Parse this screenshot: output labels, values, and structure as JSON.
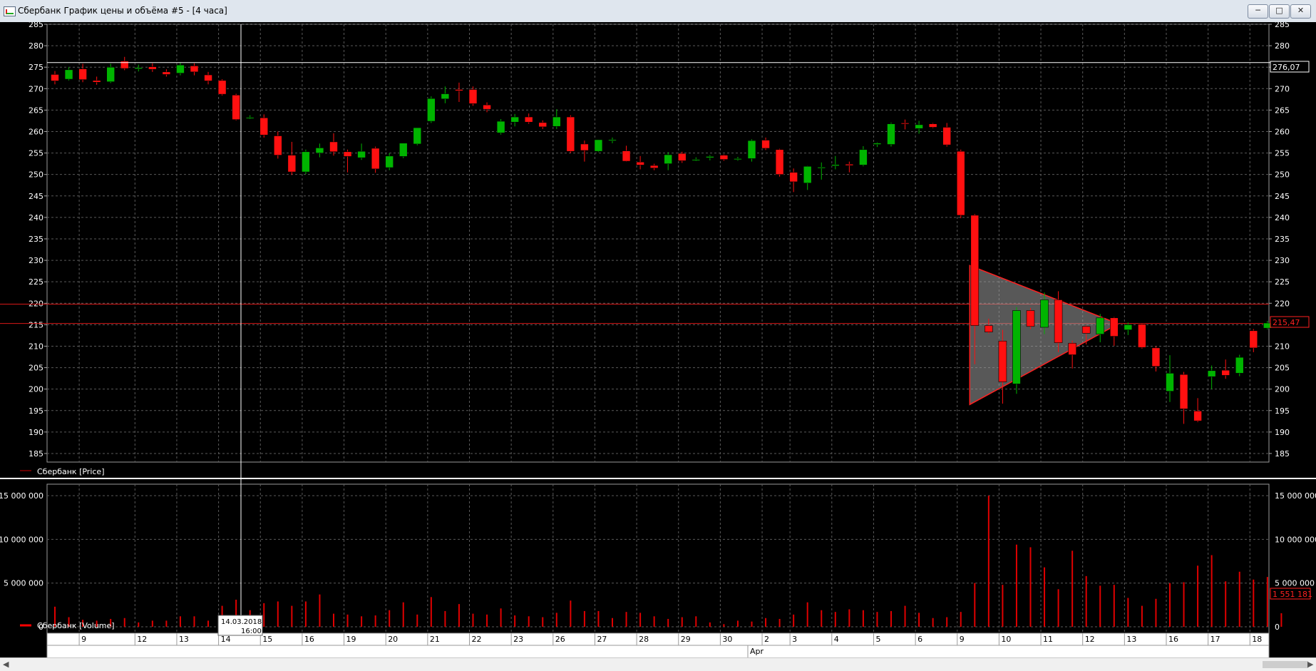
{
  "window": {
    "title": "Сбербанк График цены и объёма #5 - [4 часа]",
    "buttons": [
      "─",
      "□",
      "✕"
    ]
  },
  "colors": {
    "up": "#00b400",
    "down": "#ff1010",
    "grid": "#5a5a5a",
    "background": "#000000",
    "volume": "#e00000"
  },
  "price_panel": {
    "legend": "Сбербанк [Price]",
    "last_price_label": "215,47",
    "crosshair_price_label": "276,07",
    "levels": [
      219.8,
      215.3
    ]
  },
  "volume_panel": {
    "legend": "Сбербанк [Volume]",
    "last_volume_label": "1 551 181"
  },
  "crosshair": {
    "date_label": "14.03.2018",
    "time_label": "16:00"
  },
  "time_axis": {
    "day_labels": [
      "9",
      "12",
      "13",
      "14",
      "15",
      "16",
      "19",
      "20",
      "21",
      "22",
      "23",
      "26",
      "27",
      "28",
      "29",
      "30",
      "2",
      "3",
      "4",
      "5",
      "6",
      "9",
      "10",
      "11",
      "12",
      "13",
      "16",
      "17",
      "18"
    ],
    "month_label": "Apr"
  },
  "chart_data": {
    "type": "candlestick",
    "title": "Сбербанк График цены и объёма #5 - [4 часа]",
    "price_axis": {
      "min": 183,
      "max": 285,
      "ticks": [
        185,
        190,
        195,
        200,
        205,
        210,
        215,
        220,
        225,
        230,
        235,
        240,
        245,
        250,
        255,
        260,
        265,
        270,
        275,
        280,
        285
      ]
    },
    "volume_axis": {
      "ticks": [
        0,
        5000000,
        10000000,
        15000000
      ],
      "tick_labels": [
        "0",
        "5 000 000",
        "10 000 000",
        "15 000 000"
      ]
    },
    "candles": [
      {
        "o": 273.3,
        "h": 274.1,
        "l": 271.0,
        "c": 271.8
      },
      {
        "o": 272.2,
        "h": 275.0,
        "l": 271.9,
        "c": 274.4
      },
      {
        "o": 274.6,
        "h": 275.8,
        "l": 271.5,
        "c": 272.1
      },
      {
        "o": 271.9,
        "h": 272.8,
        "l": 270.9,
        "c": 271.5
      },
      {
        "o": 271.6,
        "h": 275.8,
        "l": 271.3,
        "c": 275.0
      },
      {
        "o": 276.4,
        "h": 277.4,
        "l": 274.3,
        "c": 274.7
      },
      {
        "o": 274.6,
        "h": 275.6,
        "l": 274.0,
        "c": 274.9
      },
      {
        "o": 275.1,
        "h": 275.9,
        "l": 273.9,
        "c": 274.5
      },
      {
        "o": 273.9,
        "h": 274.5,
        "l": 272.8,
        "c": 273.3
      },
      {
        "o": 273.6,
        "h": 276.0,
        "l": 273.1,
        "c": 275.5
      },
      {
        "o": 275.3,
        "h": 275.9,
        "l": 273.1,
        "c": 273.9
      },
      {
        "o": 273.2,
        "h": 273.9,
        "l": 271.0,
        "c": 271.8
      },
      {
        "o": 271.9,
        "h": 272.2,
        "l": 268.4,
        "c": 268.7
      },
      {
        "o": 268.5,
        "h": 268.8,
        "l": 262.6,
        "c": 262.8
      },
      {
        "o": 263.2,
        "h": 263.8,
        "l": 262.9,
        "c": 263.3
      },
      {
        "o": 263.2,
        "h": 264.0,
        "l": 258.6,
        "c": 259.2
      },
      {
        "o": 259.0,
        "h": 260.0,
        "l": 253.7,
        "c": 254.5
      },
      {
        "o": 254.5,
        "h": 257.6,
        "l": 249.9,
        "c": 250.6
      },
      {
        "o": 250.6,
        "h": 255.8,
        "l": 250.1,
        "c": 255.3
      },
      {
        "o": 255.0,
        "h": 257.2,
        "l": 254.0,
        "c": 256.2
      },
      {
        "o": 257.6,
        "h": 259.6,
        "l": 254.4,
        "c": 255.3
      },
      {
        "o": 255.3,
        "h": 255.8,
        "l": 250.5,
        "c": 254.2
      },
      {
        "o": 253.9,
        "h": 257.2,
        "l": 253.4,
        "c": 255.4
      },
      {
        "o": 256.1,
        "h": 256.5,
        "l": 250.4,
        "c": 251.3
      },
      {
        "o": 251.6,
        "h": 255.0,
        "l": 251.0,
        "c": 254.3
      },
      {
        "o": 254.2,
        "h": 256.4,
        "l": 253.8,
        "c": 257.3
      },
      {
        "o": 257.1,
        "h": 260.8,
        "l": 256.8,
        "c": 260.9
      },
      {
        "o": 262.4,
        "h": 268.2,
        "l": 262.0,
        "c": 267.7
      },
      {
        "o": 267.6,
        "h": 270.5,
        "l": 266.6,
        "c": 268.8
      },
      {
        "o": 269.8,
        "h": 271.4,
        "l": 266.9,
        "c": 269.5
      },
      {
        "o": 269.8,
        "h": 270.5,
        "l": 266.0,
        "c": 266.5
      },
      {
        "o": 266.2,
        "h": 266.8,
        "l": 264.5,
        "c": 265.2
      },
      {
        "o": 259.7,
        "h": 262.9,
        "l": 259.3,
        "c": 262.4
      },
      {
        "o": 262.2,
        "h": 264.1,
        "l": 261.2,
        "c": 263.4
      },
      {
        "o": 263.4,
        "h": 264.2,
        "l": 261.8,
        "c": 262.2
      },
      {
        "o": 262.1,
        "h": 262.6,
        "l": 260.6,
        "c": 261.1
      },
      {
        "o": 261.2,
        "h": 265.2,
        "l": 260.6,
        "c": 263.4
      },
      {
        "o": 263.4,
        "h": 263.8,
        "l": 255.0,
        "c": 255.4
      },
      {
        "o": 257.1,
        "h": 257.9,
        "l": 253.0,
        "c": 255.6
      },
      {
        "o": 255.4,
        "h": 258.1,
        "l": 255.2,
        "c": 258.1
      },
      {
        "o": 258.0,
        "h": 258.6,
        "l": 257.3,
        "c": 258.1
      },
      {
        "o": 255.5,
        "h": 256.7,
        "l": 253.0,
        "c": 253.1
      },
      {
        "o": 252.9,
        "h": 254.3,
        "l": 251.2,
        "c": 252.2
      },
      {
        "o": 252.1,
        "h": 252.5,
        "l": 251.0,
        "c": 251.5
      },
      {
        "o": 252.5,
        "h": 255.2,
        "l": 251.0,
        "c": 254.6
      },
      {
        "o": 254.9,
        "h": 255.3,
        "l": 252.7,
        "c": 253.2
      },
      {
        "o": 253.4,
        "h": 254.0,
        "l": 253.1,
        "c": 253.5
      },
      {
        "o": 253.9,
        "h": 254.5,
        "l": 253.3,
        "c": 254.2
      },
      {
        "o": 254.5,
        "h": 254.7,
        "l": 253.2,
        "c": 253.5
      },
      {
        "o": 253.6,
        "h": 254.1,
        "l": 253.2,
        "c": 253.7
      },
      {
        "o": 253.7,
        "h": 258.2,
        "l": 253.0,
        "c": 257.9
      },
      {
        "o": 258.0,
        "h": 258.6,
        "l": 255.7,
        "c": 256.1
      },
      {
        "o": 255.8,
        "h": 256.0,
        "l": 249.5,
        "c": 250.0
      },
      {
        "o": 250.5,
        "h": 251.4,
        "l": 245.9,
        "c": 248.3
      },
      {
        "o": 248.0,
        "h": 252.0,
        "l": 246.4,
        "c": 251.9
      },
      {
        "o": 251.7,
        "h": 252.8,
        "l": 248.8,
        "c": 251.7
      },
      {
        "o": 252.0,
        "h": 254.3,
        "l": 251.2,
        "c": 252.3
      },
      {
        "o": 252.4,
        "h": 253.0,
        "l": 250.5,
        "c": 252.1
      },
      {
        "o": 252.2,
        "h": 256.6,
        "l": 251.9,
        "c": 255.8
      },
      {
        "o": 257.0,
        "h": 257.5,
        "l": 256.4,
        "c": 257.3
      },
      {
        "o": 257.0,
        "h": 262.1,
        "l": 256.5,
        "c": 261.8
      },
      {
        "o": 262.0,
        "h": 262.8,
        "l": 260.5,
        "c": 261.8
      },
      {
        "o": 260.7,
        "h": 262.5,
        "l": 259.5,
        "c": 261.6
      },
      {
        "o": 261.8,
        "h": 262.0,
        "l": 260.8,
        "c": 261.0
      },
      {
        "o": 261.0,
        "h": 262.0,
        "l": 256.5,
        "c": 256.9
      },
      {
        "o": 255.4,
        "h": 255.8,
        "l": 239.8,
        "c": 240.5
      },
      {
        "o": 240.5,
        "h": 240.8,
        "l": 205.8,
        "c": 214.8
      },
      {
        "o": 214.8,
        "h": 216.4,
        "l": 212.9,
        "c": 213.3
      },
      {
        "o": 211.2,
        "h": 213.8,
        "l": 196.6,
        "c": 201.7
      },
      {
        "o": 201.2,
        "h": 219.1,
        "l": 198.9,
        "c": 218.3
      },
      {
        "o": 218.3,
        "h": 218.9,
        "l": 214.0,
        "c": 214.6
      },
      {
        "o": 214.4,
        "h": 222.5,
        "l": 212.8,
        "c": 220.8
      },
      {
        "o": 220.8,
        "h": 222.8,
        "l": 208.6,
        "c": 210.8
      },
      {
        "o": 210.7,
        "h": 211.3,
        "l": 204.8,
        "c": 208.0
      },
      {
        "o": 214.6,
        "h": 214.9,
        "l": 210.4,
        "c": 213.0
      },
      {
        "o": 212.8,
        "h": 217.5,
        "l": 210.9,
        "c": 216.6
      },
      {
        "o": 216.6,
        "h": 216.8,
        "l": 210.1,
        "c": 212.3
      },
      {
        "o": 213.8,
        "h": 215.5,
        "l": 212.6,
        "c": 215.0
      },
      {
        "o": 215.1,
        "h": 215.3,
        "l": 209.4,
        "c": 209.7
      },
      {
        "o": 209.6,
        "h": 210.0,
        "l": 204.1,
        "c": 205.3
      },
      {
        "o": 199.5,
        "h": 207.9,
        "l": 197.0,
        "c": 203.7
      },
      {
        "o": 203.4,
        "h": 204.0,
        "l": 191.9,
        "c": 195.4
      },
      {
        "o": 194.9,
        "h": 197.9,
        "l": 192.3,
        "c": 192.6
      },
      {
        "o": 202.9,
        "h": 205.5,
        "l": 200.0,
        "c": 204.3
      },
      {
        "o": 204.4,
        "h": 206.9,
        "l": 202.4,
        "c": 203.2
      },
      {
        "o": 203.7,
        "h": 208.0,
        "l": 203.0,
        "c": 207.4
      },
      {
        "o": 213.6,
        "h": 214.0,
        "l": 208.6,
        "c": 209.6
      },
      {
        "o": 214.2,
        "h": 215.9,
        "l": 213.9,
        "c": 215.4
      }
    ],
    "volumes": [
      2300000,
      1100000,
      800000,
      700000,
      900000,
      1000000,
      500000,
      700000,
      700000,
      1200000,
      1200000,
      700000,
      2400000,
      3100000,
      1900000,
      2700000,
      2900000,
      2400000,
      2900000,
      3700000,
      1500000,
      1400000,
      1200000,
      1300000,
      1900000,
      2800000,
      1400000,
      3400000,
      1800000,
      2600000,
      1500000,
      1400000,
      2100000,
      1300000,
      1200000,
      1100000,
      1600000,
      3000000,
      1800000,
      1800000,
      1000000,
      1700000,
      1600000,
      1200000,
      900000,
      1100000,
      1200000,
      500000,
      300000,
      700000,
      600000,
      1000000,
      900000,
      1400000,
      2800000,
      1900000,
      1700000,
      2000000,
      1900000,
      1700000,
      1800000,
      2400000,
      1600000,
      1000000,
      1100000,
      1700000,
      5000000,
      15000000,
      4800000,
      9400000,
      9100000,
      6800000,
      4300000,
      8700000,
      5800000,
      4700000,
      4800000,
      3300000,
      2400000,
      3200000,
      5000000,
      5100000,
      7000000,
      8200000,
      5200000,
      6300000,
      5400000,
      5700000,
      1551181
    ]
  }
}
